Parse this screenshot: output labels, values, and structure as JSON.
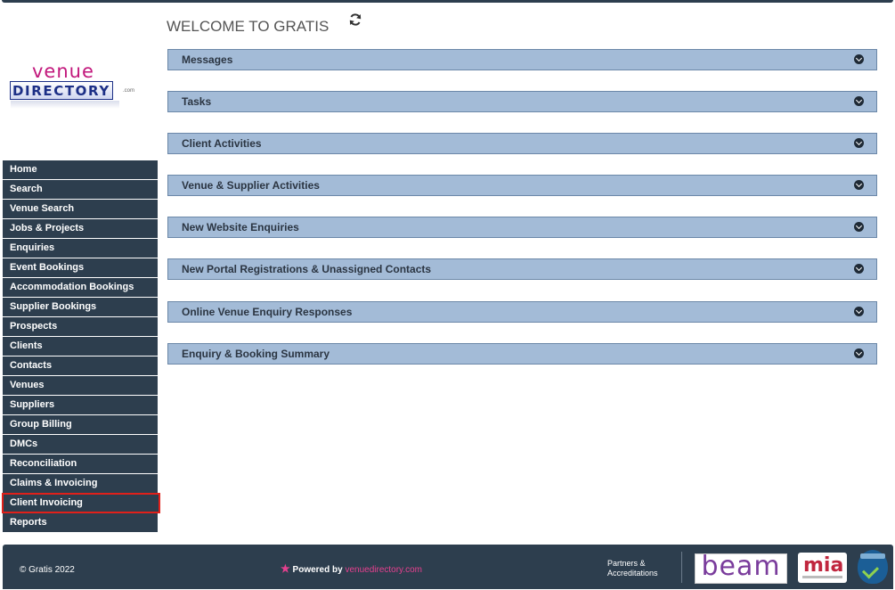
{
  "header": {
    "welcome": "WELCOME TO GRATIS"
  },
  "logo": {
    "venue": "venue",
    "directory": "DIRECTORY",
    "com": ".com"
  },
  "nav": {
    "items": [
      "Home",
      "Search",
      "Venue Search",
      "Jobs & Projects",
      "Enquiries",
      "Event Bookings",
      "Accommodation Bookings",
      "Supplier Bookings",
      "Prospects",
      "Clients",
      "Contacts",
      "Venues",
      "Suppliers",
      "Group Billing",
      "DMCs",
      "Reconciliation",
      "Claims & Invoicing",
      "Client Invoicing",
      "Reports"
    ],
    "highlighted": "Client Invoicing"
  },
  "panels": [
    "Messages",
    "Tasks",
    "Client Activities",
    "Venue & Supplier Activities",
    "New Website Enquiries",
    "New Portal Registrations & Unassigned Contacts",
    "Online Venue Enquiry Responses",
    "Enquiry & Booking Summary"
  ],
  "footer": {
    "copyright": "© Gratis 2022",
    "powered_by": "Powered by",
    "powered_brand": "venuedirectory.com",
    "partners_line1": "Partners &",
    "partners_line2": "Accreditations",
    "beam": "beam",
    "mia": "mia"
  },
  "colors": {
    "nav_bg": "#2d3e4e",
    "panel_bg": "#a3bbd7",
    "highlight": "#e0201a",
    "brand_pink": "#e6408f"
  },
  "icons": {
    "refresh": "refresh-icon",
    "panel_toggle": "chevron-down-circle-icon"
  }
}
